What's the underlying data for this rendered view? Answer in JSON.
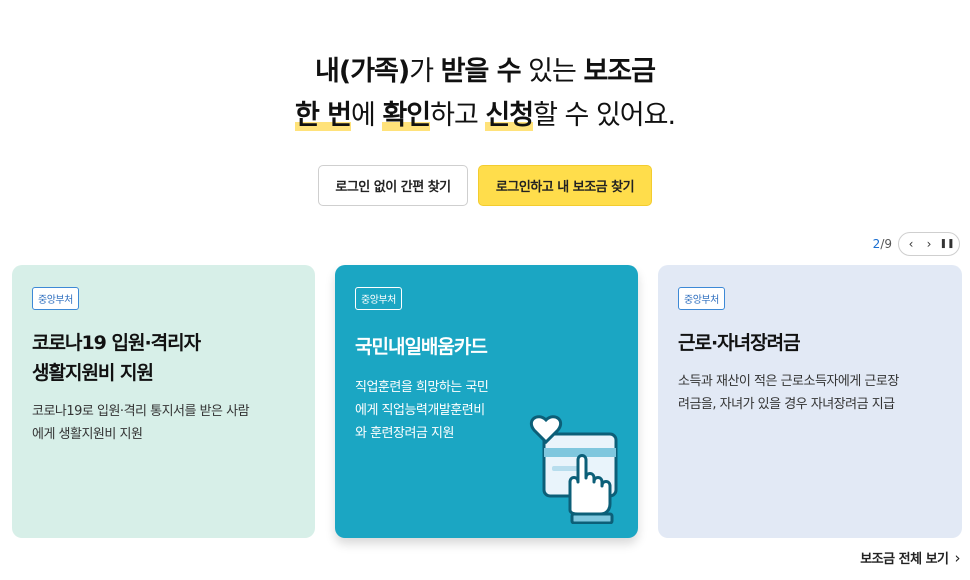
{
  "hero": {
    "line1": [
      {
        "text": "내(가족)",
        "bold": true,
        "hl": false
      },
      {
        "text": "가 ",
        "bold": false,
        "hl": false
      },
      {
        "text": "받을 수",
        "bold": true,
        "hl": false
      },
      {
        "text": " 있는 ",
        "bold": false,
        "hl": false
      },
      {
        "text": "보조금",
        "bold": true,
        "hl": false
      }
    ],
    "line2": [
      {
        "text": "한 번",
        "bold": true,
        "hl": true
      },
      {
        "text": "에 ",
        "bold": false,
        "hl": false
      },
      {
        "text": "확인",
        "bold": true,
        "hl": true
      },
      {
        "text": "하고 ",
        "bold": false,
        "hl": false
      },
      {
        "text": "신청",
        "bold": true,
        "hl": true
      },
      {
        "text": "할 수 있어요.",
        "bold": false,
        "hl": false
      }
    ]
  },
  "buttons": {
    "simple_search": "로그인 없이 간편 찾기",
    "login_search": "로그인하고 내 보조금 찾기"
  },
  "pager": {
    "current": "2",
    "separator": "/",
    "total": "9",
    "prev_icon": "‹",
    "next_icon": "›",
    "pause_icon": "❚❚"
  },
  "cards": [
    {
      "tag": "중앙부처",
      "title_lines": [
        "코로나19 입원·격리자",
        "생활지원비 지원"
      ],
      "desc_lines": [
        "코로나19로 입원·격리 통지서를 받은 사람",
        "에게 생활지원비 지원"
      ]
    },
    {
      "tag": "중앙부처",
      "title_lines": [
        "국민내일배움카드"
      ],
      "desc_lines": [
        "직업훈련을 희망하는 국민",
        "에게 직업능력개발훈련비",
        "와 훈련장려금 지원"
      ],
      "illustration": "card-heart-hand-icon"
    },
    {
      "tag": "중앙부처",
      "title_lines": [
        "근로·자녀장려금"
      ],
      "desc_lines": [
        "소득과 재산이 적은 근로소득자에게 근로장",
        "려금을, 자녀가 있을 경우 자녀장려금 지급"
      ]
    }
  ],
  "all_link": {
    "label": "보조금 전체 보기",
    "icon": "›"
  },
  "colors": {
    "highlight": "#ffe27a",
    "primary_button": "#ffdd4b",
    "card1_bg": "#d7efe8",
    "card2_bg": "#1ba6c3",
    "card3_bg": "#e2e9f5",
    "tag_blue": "#3d89d6",
    "pager_current": "#1b6fd1"
  }
}
